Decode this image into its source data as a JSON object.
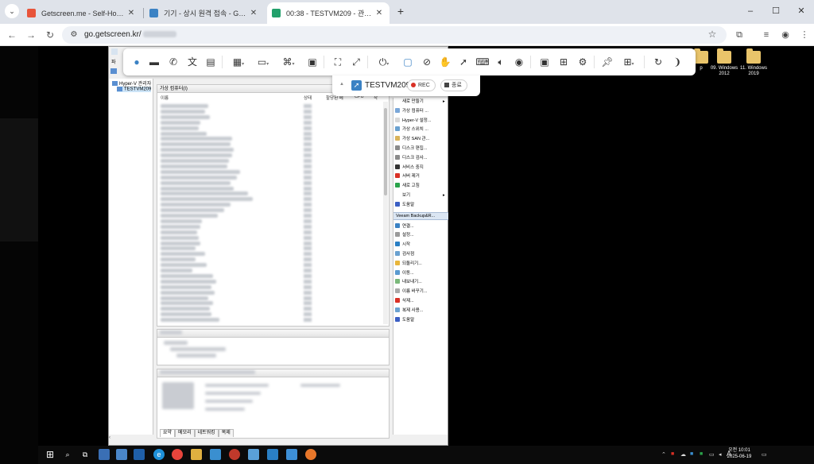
{
  "browser": {
    "tabs": [
      {
        "title": "Getscreen.me - Self-Hosted - ",
        "color": "#e8543a",
        "active": false
      },
      {
        "title": "기기 - 상시 원격 접속 - Getsc",
        "color": "#3b82c4",
        "active": false
      },
      {
        "title": "00:38 - TESTVM209 - 관리자 :",
        "color": "#22a06b",
        "active": true
      }
    ],
    "new_tab": "+",
    "window_controls": {
      "minimize": "–",
      "maximize": "☐",
      "close": "✕"
    },
    "address": {
      "url": "go.getscreen.kr/"
    }
  },
  "getscreen": {
    "session_name": "TESTVM209",
    "rec_label": "REC",
    "stop_label": "종료",
    "accent": "#3b82c4"
  },
  "desktop": {
    "icons": [
      {
        "label": "p"
      },
      {
        "label": "09. Windows 2012"
      },
      {
        "label": "11. Windows 2019"
      }
    ]
  },
  "hyperv": {
    "menu_fragment": "파",
    "tree": [
      {
        "label": "Hyper-V 관리자"
      },
      {
        "label": "TESTVM209"
      }
    ],
    "vm_panel": {
      "title": "가상 컴퓨터(I)",
      "columns": [
        "이름",
        "상태",
        "할당된 메",
        "CPU",
        "작"
      ]
    },
    "bottom_tabs": [
      "요약",
      "메모리",
      "네트워킹",
      "복제"
    ],
    "tree_scroll": "‹",
    "actions": {
      "group1": [
        {
          "label": "새로 만들기",
          "arrow": "▸",
          "color": "#ffffff"
        },
        {
          "label": "가상 컴퓨터 ...",
          "color": "#7aa7d8"
        },
        {
          "label": "Hyper-V 설정...",
          "color": "#d8d8d8"
        },
        {
          "label": "가상 스위치 ...",
          "color": "#6aa1d0"
        },
        {
          "label": "가상 SAN 관...",
          "color": "#d9b35a"
        },
        {
          "label": "디스크 편집...",
          "color": "#8a8a8a"
        },
        {
          "label": "디스크 검사...",
          "color": "#8a8a8a"
        },
        {
          "label": "서비스 중지",
          "color": "#333333"
        },
        {
          "label": "서버 제거",
          "color": "#d93025"
        },
        {
          "label": "새로 고침",
          "color": "#2aa34a"
        },
        {
          "label": "보기",
          "arrow": "▸",
          "color": "#ffffff"
        },
        {
          "label": "도움말",
          "color": "#3b5fc4"
        }
      ],
      "group2_header": "Veeam Backup&R...",
      "group2": [
        {
          "label": "연결...",
          "color": "#3b82c4"
        },
        {
          "label": "설정...",
          "color": "#9a9a9a"
        },
        {
          "label": "시작",
          "color": "#2a7fc4"
        },
        {
          "label": "검사점",
          "color": "#6aa1d0"
        },
        {
          "label": "되돌리기...",
          "color": "#e8b53a"
        },
        {
          "label": "이동...",
          "color": "#5a9ad0"
        },
        {
          "label": "내보내기...",
          "color": "#7ab87a"
        },
        {
          "label": "이름 바꾸기...",
          "color": "#aaaaaa"
        },
        {
          "label": "삭제...",
          "color": "#d93025"
        },
        {
          "label": "복제 사용...",
          "color": "#6aa1d0"
        },
        {
          "label": "도움말",
          "color": "#3b5fc4"
        }
      ]
    }
  },
  "taskbar": {
    "clock_time": "오전 10:01",
    "clock_date": "2025-06-19",
    "ime": "A"
  }
}
